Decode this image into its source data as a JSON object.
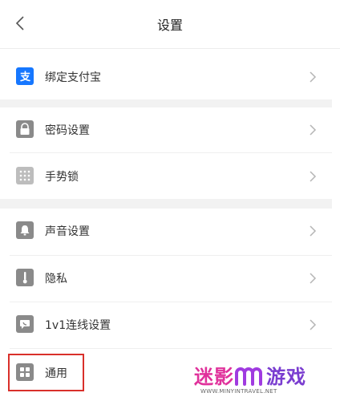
{
  "header": {
    "title": "设置",
    "back_icon": "chevron-left-icon"
  },
  "rows": [
    {
      "label": "绑定支付宝",
      "icon": "alipay-icon"
    },
    {
      "label": "密码设置",
      "icon": "lock-icon"
    },
    {
      "label": "手势锁",
      "icon": "gesture-grid-icon"
    },
    {
      "label": "声音设置",
      "icon": "bell-icon"
    },
    {
      "label": "隐私",
      "icon": "privacy-icon"
    },
    {
      "label": "1v1连线设置",
      "icon": "phone-chat-icon"
    },
    {
      "label": "通用",
      "icon": "grid-icon"
    }
  ],
  "colors": {
    "accent_alipay": "#1677ff",
    "icon_gray": "#8a8a8a",
    "highlight_red": "#d9302b"
  },
  "watermark": {
    "text_a": "迷影",
    "text_b": "游戏",
    "url": "WWW.MINYINTRAVEL.NET"
  }
}
